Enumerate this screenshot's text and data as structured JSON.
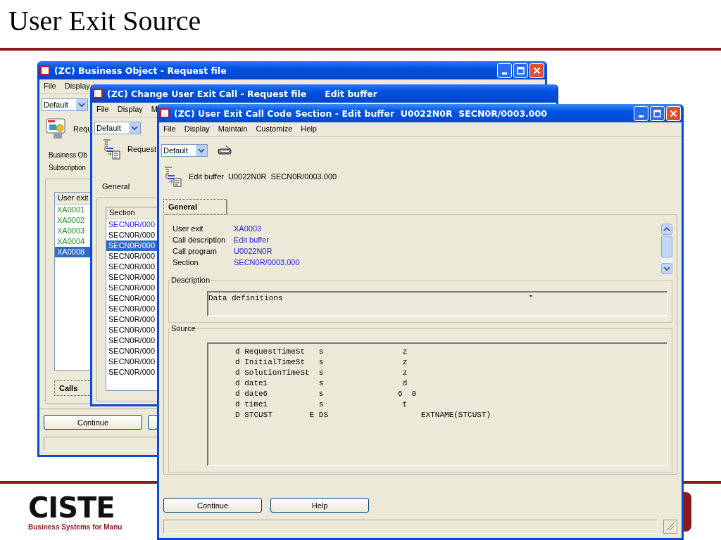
{
  "slide": {
    "title": "User Exit Source",
    "logo": {
      "name": "CISTE",
      "tagline": "Business Systems for Manu"
    }
  },
  "business_object_window": {
    "title": "(ZC) Business Object - Request file",
    "active": false,
    "menu": [
      "File",
      "Display"
    ],
    "view_select": "Default",
    "header": "Requ",
    "side_tabs": [
      "Business Ob",
      "Subscription"
    ],
    "user_exit_list": {
      "header": "User exit",
      "items": [
        {
          "text": "XA0001",
          "selected": false
        },
        {
          "text": "XA0002",
          "selected": false
        },
        {
          "text": "XA0003",
          "selected": false
        },
        {
          "text": "XA0004",
          "selected": false
        },
        {
          "text": "XA0008",
          "selected": true
        }
      ]
    },
    "bottom_tab": "Calls",
    "buttons": [
      "Continue"
    ]
  },
  "change_call_window": {
    "title": "(ZC) Change User Exit Call - Request file",
    "title_extra": "Edit buffer",
    "active": false,
    "menu": [
      "File",
      "Display",
      "M"
    ],
    "view_select": "Default",
    "header": "Request",
    "tab": "General",
    "section_list": {
      "header": "Section",
      "rows": [
        {
          "text": "SECN0R/000",
          "selected": false,
          "color": "#1a1adc"
        },
        {
          "text": "SECN0R/000",
          "selected": false,
          "color": "#000000"
        },
        {
          "text": "SECN0R/000",
          "selected": true,
          "color": "#ffffff"
        },
        {
          "text": "SECN0R/000",
          "selected": false,
          "color": "#000000"
        },
        {
          "text": "SECN0R/000",
          "selected": false,
          "color": "#000000"
        },
        {
          "text": "SECN0R/000",
          "selected": false,
          "color": "#000000"
        },
        {
          "text": "SECN0R/000",
          "selected": false,
          "color": "#000000"
        },
        {
          "text": "SECN0R/000",
          "selected": false,
          "color": "#000000"
        },
        {
          "text": "SECN0R/000",
          "selected": false,
          "color": "#000000"
        },
        {
          "text": "SECN0R/000",
          "selected": false,
          "color": "#000000"
        },
        {
          "text": "SECN0R/000",
          "selected": false,
          "color": "#000000"
        },
        {
          "text": "SECN0R/000",
          "selected": false,
          "color": "#000000"
        },
        {
          "text": "SECN0R/000",
          "selected": false,
          "color": "#000000"
        },
        {
          "text": "SECN0R/000",
          "selected": false,
          "color": "#000000"
        },
        {
          "text": "SECN0R/000",
          "selected": false,
          "color": "#000000"
        }
      ]
    }
  },
  "code_section_window": {
    "title": "(ZC) User Exit Call Code Section - Edit buffer  U0022N0R  SECN0R/0003.000",
    "active": true,
    "menu": [
      "File",
      "Display",
      "Maintain",
      "Customize",
      "Help"
    ],
    "view_select": "Default",
    "header": "Edit buffer  U0022N0R  SECN0R/0003.000",
    "tabs": [
      {
        "label": "General",
        "selected": true
      }
    ],
    "fields": [
      {
        "label": "User exit",
        "value": "XA0003"
      },
      {
        "label": "Call description",
        "value": "Edit buffer"
      },
      {
        "label": "Call program",
        "value": "U0022N0R"
      },
      {
        "label": "Section",
        "value": "SECN0R/0003.000"
      }
    ],
    "description": {
      "label": "Description",
      "text": "Data definitions",
      "mark": "*"
    },
    "source": {
      "label": "Source",
      "lines": [
        "d RequestTimeSt   s                 z",
        "d InitialTimeSt   s                 z",
        "d SolutionTimeSt  s                 z",
        "d date1           s                 d",
        "d date6           s                6  0",
        "d time1           s                 t",
        "D STCUST        E DS                    EXTNAME(STCUST)"
      ]
    },
    "buttons": [
      "Continue",
      "Help"
    ]
  }
}
